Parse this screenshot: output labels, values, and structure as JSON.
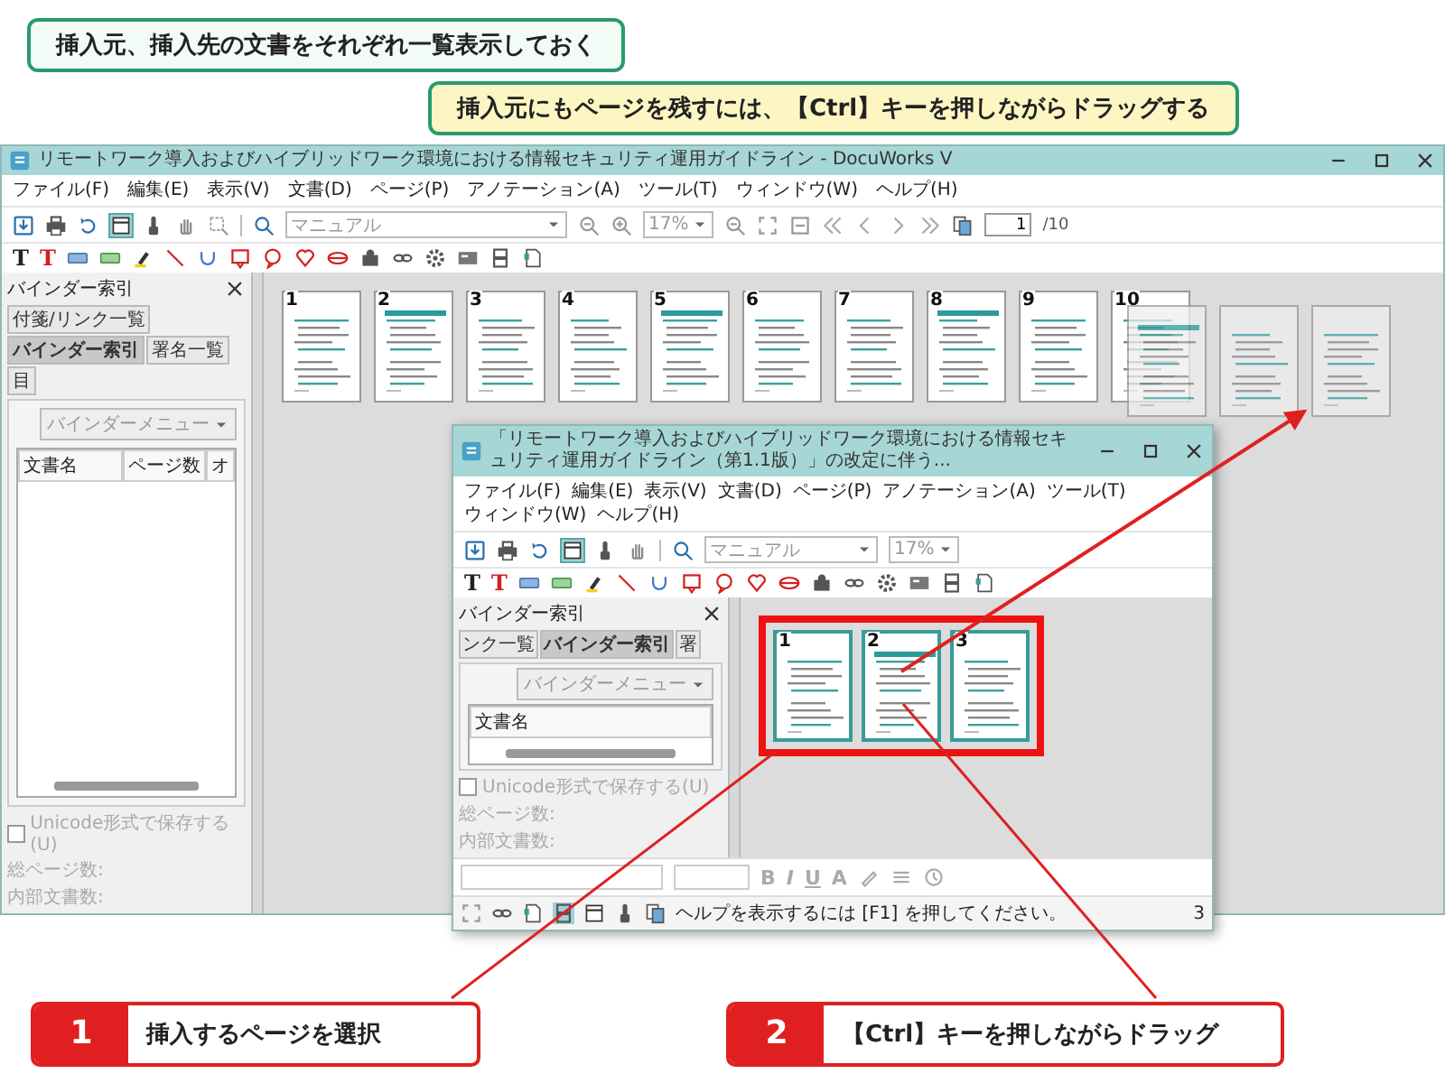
{
  "callouts": [
    {
      "kind": "plain",
      "text": "挿入元、挿入先の文書をそれぞれ一覧表示しておく"
    },
    {
      "kind": "note",
      "text": "挿入元にもページを残すには、【Ctrl】キーを押しながらドラッグする"
    }
  ],
  "main_window": {
    "title": "リモートワーク導入およびハイブリッドワーク環境における情報セキュリティ運用ガイドライン - DocuWorks V",
    "menu": [
      "ファイル(F)",
      "編集(E)",
      "表示(V)",
      "文書(D)",
      "ページ(P)",
      "アノテーション(A)",
      "ツール(T)",
      "ウィンドウ(W)",
      "ヘルプ(H)"
    ],
    "annotation_tools": [
      {
        "glyph": "T",
        "color": "#222222"
      },
      {
        "glyph": "T",
        "color": "#d42020"
      }
    ],
    "zoom_mode": "マニュアル",
    "zoom": "17%",
    "page": "1",
    "page_total": "/10",
    "side_panel": {
      "title": "バインダー索引",
      "tabs": [
        {
          "label": "付箋/リンク一覧",
          "selected": false
        },
        {
          "label": "バインダー索引",
          "selected": true
        },
        {
          "label": "署名一覧",
          "selected": false
        },
        {
          "label": "目",
          "selected": false
        }
      ],
      "menu_button": "バインダーメニュー",
      "columns": [
        "文書名",
        "ページ数",
        "オ"
      ],
      "checkbox": {
        "label": "Unicode形式で保存する(U)",
        "checked": false
      },
      "stats": [
        "総ページ数:",
        "内部文書数:"
      ]
    },
    "pages": [
      {
        "kind": "page",
        "number": "1",
        "selected": false
      },
      {
        "kind": "page",
        "number": "2",
        "selected": false
      },
      {
        "kind": "page",
        "number": "3",
        "selected": false
      },
      {
        "kind": "page",
        "number": "4",
        "selected": false
      },
      {
        "kind": "page",
        "number": "5",
        "selected": false
      },
      {
        "kind": "page",
        "number": "6",
        "selected": false
      },
      {
        "kind": "page",
        "number": "7",
        "selected": false
      },
      {
        "kind": "page",
        "number": "8",
        "selected": false
      },
      {
        "kind": "page",
        "number": "9",
        "selected": false
      },
      {
        "kind": "page",
        "number": "10",
        "selected": false
      },
      {
        "kind": "ghost",
        "selected": false
      },
      {
        "kind": "ghost",
        "selected": false
      },
      {
        "kind": "ghost",
        "selected": false
      }
    ]
  },
  "nested_window": {
    "title": "「リモートワーク導入およびハイブリッドワーク環境における情報セキュリティ運用ガイドライン（第1.1版）」の改定に伴う...",
    "menu": [
      "ファイル(F)",
      "編集(E)",
      "表示(V)",
      "文書(D)",
      "ページ(P)",
      "アノテーション(A)",
      "ツール(T)",
      "ウィンドウ(W)",
      "ヘルプ(H)"
    ],
    "annotation_tools": [
      {
        "glyph": "T",
        "color": "#222222"
      },
      {
        "glyph": "T",
        "color": "#d42020"
      }
    ],
    "zoom_mode": "マニュアル",
    "zoom": "17%",
    "side_panel": {
      "title": "バインダー索引",
      "tabs": [
        {
          "label": "ンク一覧",
          "selected": false
        },
        {
          "label": "バインダー索引",
          "selected": true
        },
        {
          "label": "署",
          "selected": false
        }
      ],
      "menu_button": "バインダーメニュー",
      "columns": [
        "文書名"
      ],
      "checkbox": {
        "label": "Unicode形式で保存する(U)",
        "checked": false
      },
      "stats": [
        "総ページ数:",
        "内部文書数:"
      ]
    },
    "pages": [
      {
        "kind": "page",
        "number": "1",
        "selected": true
      },
      {
        "kind": "page",
        "number": "2",
        "selected": true
      },
      {
        "kind": "page",
        "number": "3",
        "selected": true
      }
    ],
    "format_buttons": [
      "B",
      "I",
      "U",
      "A"
    ],
    "status": "ヘルプを表示するには [F1] を押してください。",
    "page_indicator": "3"
  },
  "steps": [
    {
      "number": "1",
      "text": "挿入するページを選択"
    },
    {
      "number": "2",
      "text": "【Ctrl】キーを押しながらドラッグ"
    }
  ]
}
